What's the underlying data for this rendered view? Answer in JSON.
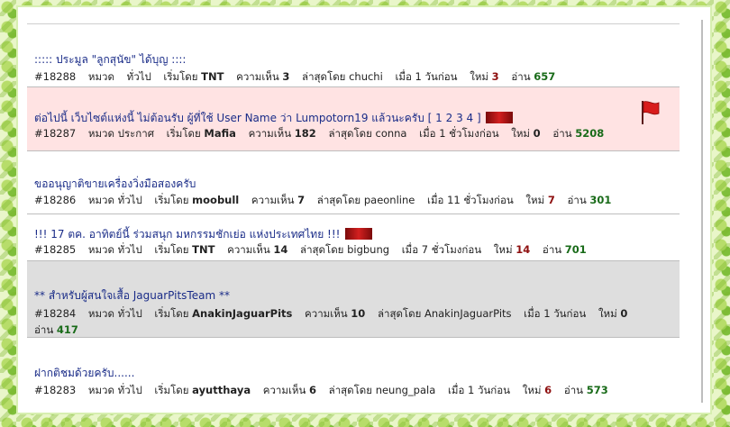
{
  "topics": [
    {
      "title": "::::: ประมูล \"ลูกสุนัข\" ได้บุญ ::::",
      "id": "#18288",
      "category_label": "หมวด",
      "category": "ทั่วไป",
      "starter_label": "เริ่มโดย",
      "starter": "TNT",
      "comments_label": "ความเห็น",
      "comments": "3",
      "last_label": "ล่าสุดโดย",
      "last_by": "chuchi",
      "when": "เมื่อ 1 วันก่อน",
      "new_label": "ใหม่",
      "new_count": "3",
      "read_label": "อ่าน",
      "read_count": "657"
    },
    {
      "title": "ต่อไปนี้ เว็บไซต์แห่งนี้ ไม่ต้อนรับ ผู้ที่ใช้ User Name ว่า Lumpotorn19 แล้วนะครับ",
      "pages": "[ 1 2 3 4 ]",
      "id": "#18287",
      "category_label": "หมวด",
      "category": "ประกาศ",
      "starter_label": "เริ่มโดย",
      "starter": "Mafia",
      "comments_label": "ความเห็น",
      "comments": "182",
      "last_label": "ล่าสุดโดย",
      "last_by": "conna",
      "when": "เมื่อ 1 ชั่วโมงก่อน",
      "new_label": "ใหม่",
      "new_count": "0",
      "read_label": "อ่าน",
      "read_count": "5208",
      "flag_icon": "red-flag-icon",
      "badge_icon": "hot-bar-icon"
    },
    {
      "title": "ขออนุญาติขายเครื่องวิ่งมือสองครับ",
      "id": "#18286",
      "category_label": "หมวด",
      "category": "ทั่วไป",
      "starter_label": "เริ่มโดย",
      "starter": "moobull",
      "comments_label": "ความเห็น",
      "comments": "7",
      "last_label": "ล่าสุดโดย",
      "last_by": "paeonline",
      "when": "เมื่อ 11 ชั่วโมงก่อน",
      "new_label": "ใหม่",
      "new_count": "7",
      "read_label": "อ่าน",
      "read_count": "301"
    },
    {
      "title": "!!! 17 ตค. อาทิตย์นี้ ร่วมสนุก มหกรรมชักเย่อ แห่งประเทศไทย !!!",
      "id": "#18285",
      "category_label": "หมวด",
      "category": "ทั่วไป",
      "starter_label": "เริ่มโดย",
      "starter": "TNT",
      "comments_label": "ความเห็น",
      "comments": "14",
      "last_label": "ล่าสุดโดย",
      "last_by": "bigbung",
      "when": "เมื่อ 7 ชั่วโมงก่อน",
      "new_label": "ใหม่",
      "new_count": "14",
      "read_label": "อ่าน",
      "read_count": "701",
      "badge_icon": "hot-bar-icon"
    },
    {
      "title": "** สำหรับผู้สนใจเสื้อ JaguarPitsTeam **",
      "id": "#18284",
      "category_label": "หมวด",
      "category": "ทั่วไป",
      "starter_label": "เริ่มโดย",
      "starter": "AnakinJaguarPits",
      "comments_label": "ความเห็น",
      "comments": "10",
      "last_label": "ล่าสุดโดย",
      "last_by": "AnakinJaguarPits",
      "when": "เมื่อ 1 วันก่อน",
      "new_label": "ใหม่",
      "new_count": "0",
      "read_label": "อ่าน",
      "read_count": "417"
    },
    {
      "title": "ฝากติชมด้วยครับ......",
      "id": "#18283",
      "category_label": "หมวด",
      "category": "ทั่วไป",
      "starter_label": "เริ่มโดย",
      "starter": "ayutthaya",
      "comments_label": "ความเห็น",
      "comments": "6",
      "last_label": "ล่าสุดโดย",
      "last_by": "neung_pala",
      "when": "เมื่อ 1 วันก่อน",
      "new_label": "ใหม่",
      "new_count": "6",
      "read_label": "อ่าน",
      "read_count": "573"
    }
  ],
  "colors": {
    "title_blue": "#1a2c88",
    "highlight_pink": "#ffe3e3",
    "highlight_grey": "#dedede",
    "count_green": "#196b19",
    "count_red": "#8e1010"
  }
}
